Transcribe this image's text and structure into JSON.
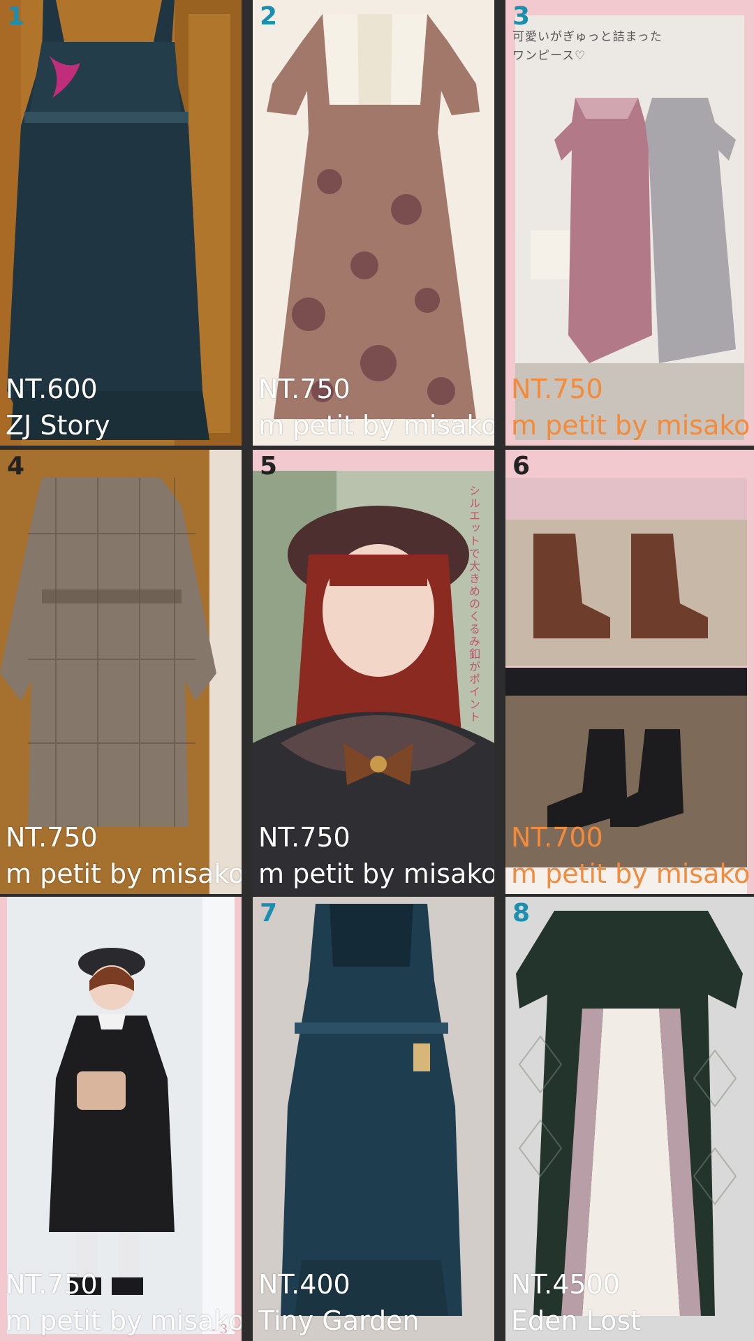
{
  "items": [
    {
      "number": "1",
      "price": "NT.600",
      "brand": "ZJ Story"
    },
    {
      "number": "2",
      "price": "NT.750",
      "brand": "m petit by misako"
    },
    {
      "number": "3",
      "price": "NT.750",
      "brand": "m petit by misako",
      "caption": "可愛いがぎゅっと詰まった\nワンピース♡"
    },
    {
      "number": "4",
      "price": "NT.750",
      "brand": "m petit by misako"
    },
    {
      "number": "5",
      "price": "NT.750",
      "brand": "m petit by misako",
      "vertical_text": "シルエットで大きめのくるみ釦がポイント"
    },
    {
      "number": "6",
      "price": "NT.700",
      "brand": "m petit by misako"
    },
    {
      "number": "",
      "price": "NT.750",
      "brand": "m petit by misako",
      "page": "- 3 -"
    },
    {
      "number": "7",
      "price": "NT.400",
      "brand": "Tiny Garden"
    },
    {
      "number": "8",
      "price": "NT.4500",
      "brand": "Eden Lost"
    }
  ],
  "colors": {
    "number_accent": "#1a8fb0",
    "orange_text": "#f28b3c",
    "pink_frame": "#f1c9cf",
    "gap": "#2d2d2d"
  }
}
